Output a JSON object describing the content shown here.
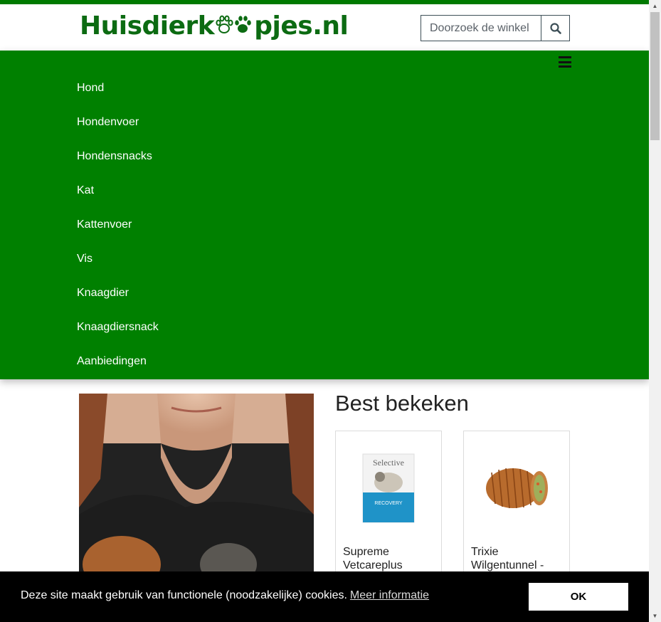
{
  "header": {
    "logo_part1": "Huisdierk",
    "logo_part2": "pjes.nl",
    "search_placeholder": "Doorzoek de winkel",
    "search_icon": "search-icon",
    "brand_color": "#0c6b12"
  },
  "menu": {
    "icon": "hamburger-icon",
    "background": "#008000",
    "items": [
      {
        "label": "Hond"
      },
      {
        "label": "Hondenvoer"
      },
      {
        "label": "Hondensnacks"
      },
      {
        "label": "Kat"
      },
      {
        "label": "Kattenvoer"
      },
      {
        "label": "Vis"
      },
      {
        "label": "Knaagdier"
      },
      {
        "label": "Knaagdiersnack"
      },
      {
        "label": "Aanbiedingen"
      }
    ]
  },
  "main": {
    "section_title": "Best bekeken",
    "products": [
      {
        "name": "Supreme Vetcareplus",
        "image_text": "Selective",
        "image_sub": "RECOVERY"
      },
      {
        "name": "Trixie Wilgentunnel -"
      }
    ]
  },
  "cookie": {
    "text": "Deze site maakt gebruik van functionele (noodzakelijke) cookies.",
    "more_link": "Meer informatie",
    "ok_label": "OK"
  }
}
